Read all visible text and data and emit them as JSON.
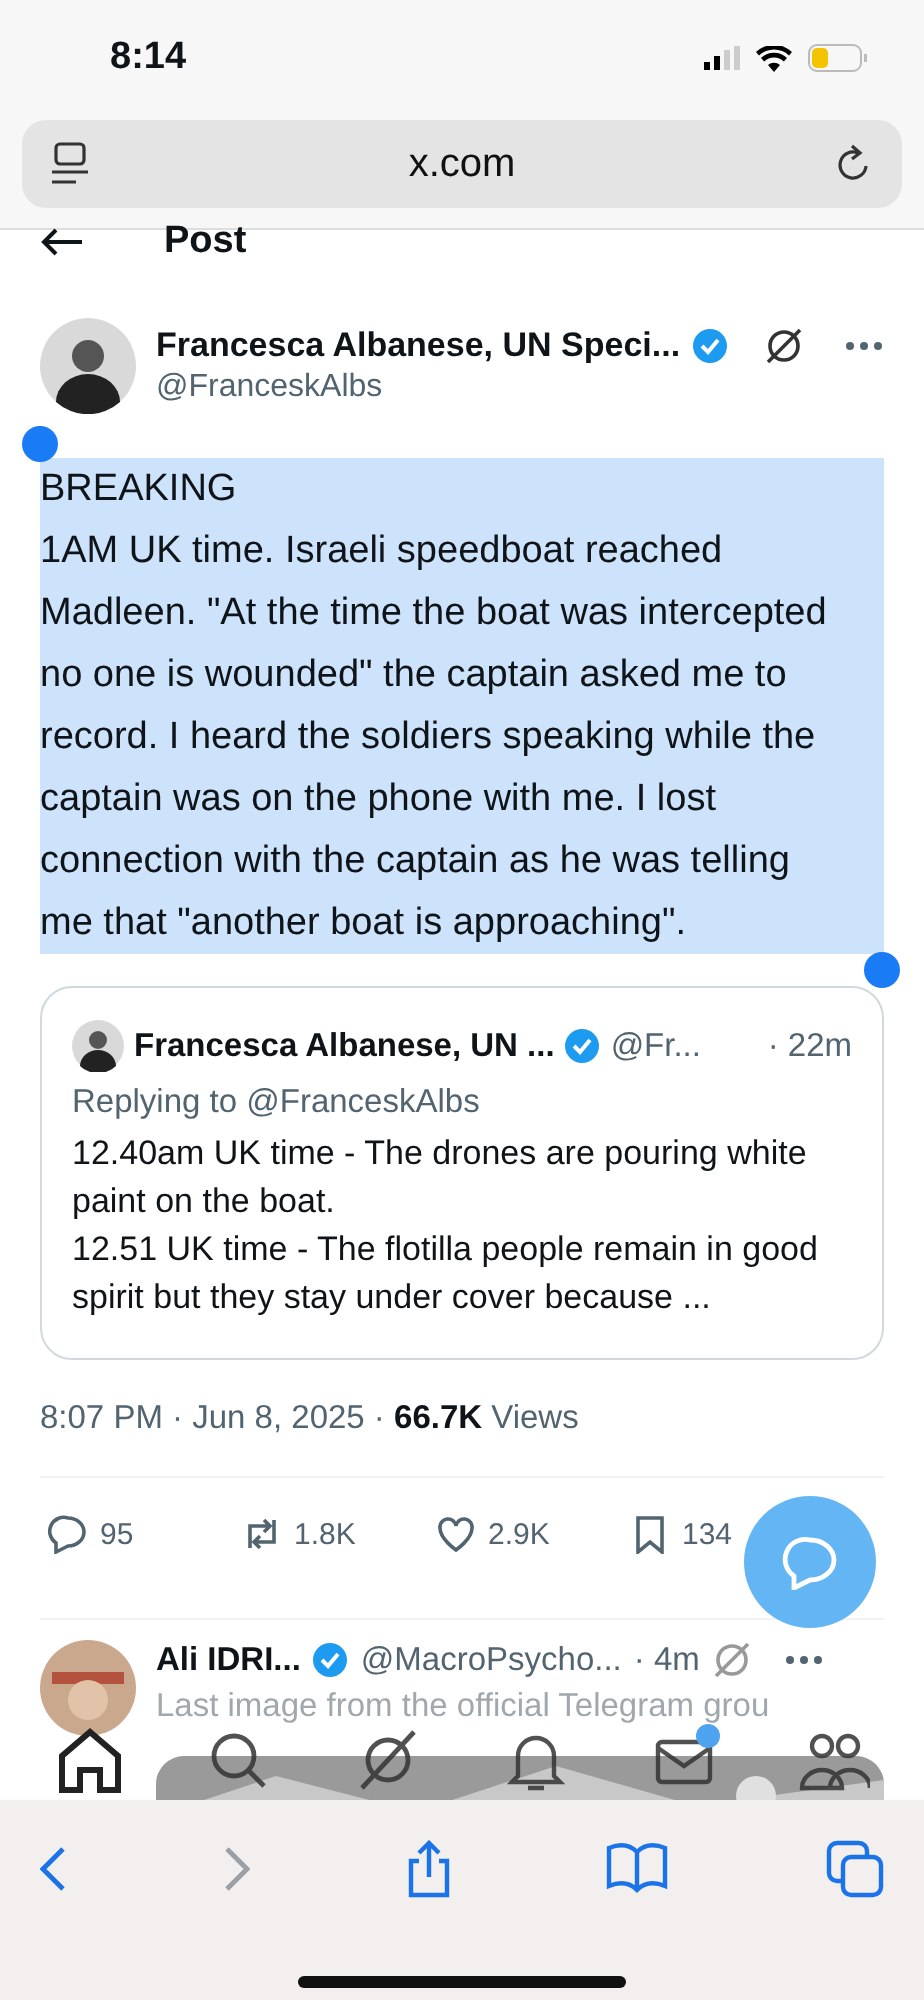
{
  "status_bar": {
    "time": "8:14"
  },
  "browser": {
    "url": "x.com"
  },
  "header": {
    "title": "Post"
  },
  "post": {
    "author": "Francesca Albanese, UN Speci...",
    "verified": true,
    "handle": "@FranceskAlbs",
    "text_lines": [
      "BREAKING",
      "1AM UK time. Israeli speedboat reached Madleen. \"At the time the boat was intercepted no one is wounded\" the captain asked me to record. I heard the soldiers speaking while the captain was on the phone with me. I lost connection with the captain as he was telling me that \"another boat is approaching\"."
    ],
    "selected": true,
    "quote": {
      "author": "Francesca Albanese, UN ...",
      "verified": true,
      "handle": "@Fr...",
      "time": "· 22m",
      "replying_to": "Replying to @FranceskAlbs",
      "text": "12.40am UK time - The drones are pouring white paint on the boat.\n12.51 UK time - The flotilla people remain in good spirit but they stay under cover because ..."
    },
    "timestamp": "8:07 PM · Jun 8, 2025 · ",
    "views_count": "66.7K",
    "views_label": "Views",
    "actions": [
      {
        "kind": "reply",
        "count": "95"
      },
      {
        "kind": "repost",
        "count": "1.8K"
      },
      {
        "kind": "like",
        "count": "2.9K"
      },
      {
        "kind": "bookmark",
        "count": "134"
      }
    ]
  },
  "next_post": {
    "author": "Ali IDRI...",
    "verified": true,
    "handle": "@MacroPsycho...",
    "time": "· 4m",
    "text": "Last image from the official Telegram grou"
  },
  "tab_bar": [
    {
      "kind": "home",
      "selected": true
    },
    {
      "kind": "search",
      "selected": false
    },
    {
      "kind": "grok",
      "selected": false
    },
    {
      "kind": "notifications",
      "selected": false
    },
    {
      "kind": "messages",
      "selected": false,
      "unread": true
    },
    {
      "kind": "communities",
      "selected": false
    }
  ],
  "safari_toolbar": [
    {
      "kind": "back",
      "disabled": false
    },
    {
      "kind": "forward",
      "disabled": true
    },
    {
      "kind": "share",
      "disabled": false
    },
    {
      "kind": "bookmarks",
      "disabled": false
    },
    {
      "kind": "tabs",
      "disabled": false
    }
  ]
}
